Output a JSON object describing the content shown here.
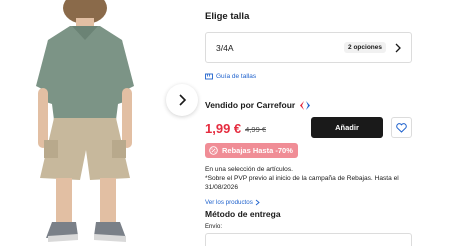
{
  "size_section": {
    "title": "Elige talla",
    "selected_size": "3/4A",
    "options_badge": "2 opciones",
    "size_guide_label": "Guía de tallas"
  },
  "seller": {
    "label": "Vendido por Carrefour"
  },
  "pricing": {
    "price": "1,99 €",
    "old_price": "4,99 €",
    "add_button_label": "Añadir"
  },
  "promo": {
    "badge_label": "Rebajas Hasta -70%",
    "description": "En una selección de artículos.\n*Sobre el PVP previo al inicio de la campaña de Rebajas. Hasta el 31/08/2026",
    "view_products_label": "Ver los productos"
  },
  "delivery": {
    "title": "Método de entrega",
    "shipping_label": "Envío:"
  },
  "colors": {
    "price_red": "#e52c3f",
    "link_blue": "#1f62cd",
    "promo_pink": "#f08d96",
    "button_dark": "#1a1a1a",
    "carrefour_blue": "#1f62cd",
    "carrefour_red": "#e52c3f"
  },
  "icons": [
    "chevron-right-icon",
    "ruler-icon",
    "carrefour-logo-icon",
    "heart-icon",
    "percent-tag-icon"
  ]
}
